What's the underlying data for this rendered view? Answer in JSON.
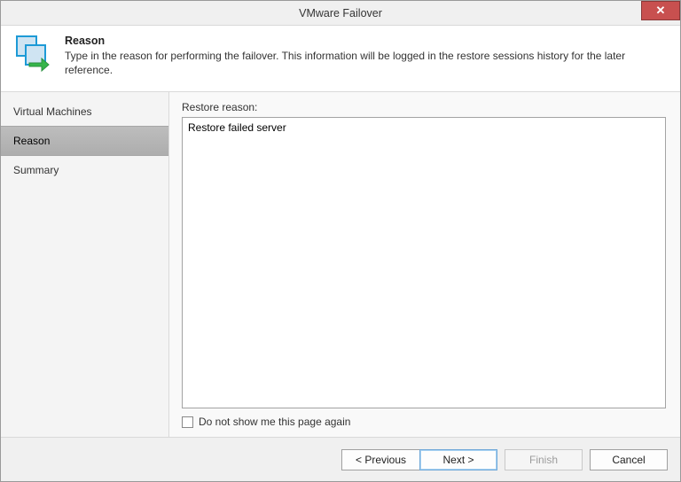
{
  "window": {
    "title": "VMware Failover",
    "close_glyph": "✕"
  },
  "header": {
    "title": "Reason",
    "description": "Type in the reason for performing the failover. This information will be logged in the restore sessions history for the later reference."
  },
  "sidebar": {
    "items": [
      {
        "label": "Virtual Machines",
        "active": false
      },
      {
        "label": "Reason",
        "active": true
      },
      {
        "label": "Summary",
        "active": false
      }
    ]
  },
  "main": {
    "reason_label": "Restore reason:",
    "reason_value": "Restore failed server",
    "checkbox_label": "Do not show me this page again"
  },
  "footer": {
    "previous": "< Previous",
    "next": "Next >",
    "finish": "Finish",
    "cancel": "Cancel"
  }
}
